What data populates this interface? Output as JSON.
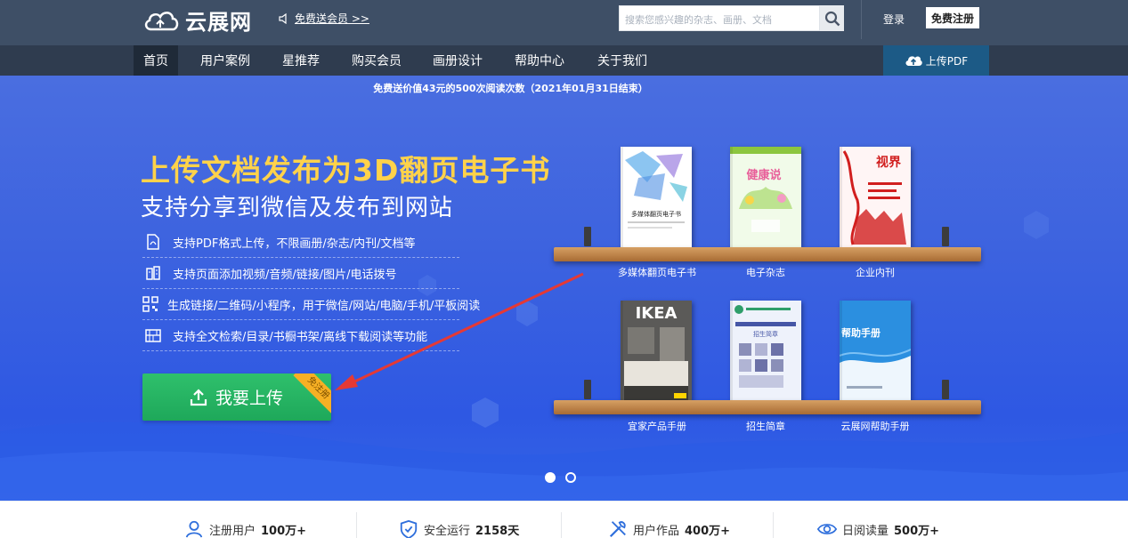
{
  "header": {
    "logo_text": "云展网",
    "promo_text": "免费送会员 >>",
    "search_placeholder": "搜索您感兴趣的杂志、画册、文档",
    "login": "登录",
    "register": "免费注册"
  },
  "nav": {
    "items": [
      {
        "label": "首页",
        "active": true
      },
      {
        "label": "用户案例",
        "active": false
      },
      {
        "label": "星推荐",
        "active": false
      },
      {
        "label": "购买会员",
        "active": false
      },
      {
        "label": "画册设计",
        "active": false
      },
      {
        "label": "帮助中心",
        "active": false
      },
      {
        "label": "关于我们",
        "active": false
      }
    ],
    "upload_pdf": "上传PDF"
  },
  "hero": {
    "promo_line": "免费送价值43元的500次阅读次数（2021年01月31日结束）",
    "headline": "上传文档发布为3D翻页电子书",
    "subheadline": "支持分享到微信及发布到网站",
    "features": [
      {
        "icon": "pdf-file-icon",
        "text": "支持PDF格式上传，不限画册/杂志/内刊/文档等"
      },
      {
        "icon": "media-grid-icon",
        "text": "支持页面添加视频/音频/链接/图片/电话拨号"
      },
      {
        "icon": "qrcode-icon",
        "text": "生成链接/二维码/小程序，用于微信/网站/电脑/手机/平板阅读"
      },
      {
        "icon": "bookshelf-icon",
        "text": "支持全文检索/目录/书橱书架/离线下载阅读等功能"
      }
    ],
    "upload_button": "我要上传",
    "upload_badge": "免注册",
    "books_top": [
      {
        "title": "多媒体翻页电子书",
        "cover_text": "多媒体翻页电子书",
        "cover_color": "#ffffff",
        "accent": "#6fb6ee"
      },
      {
        "title": "电子杂志",
        "cover_text": "健康说",
        "cover_color": "#f1fbe9",
        "accent": "#8cc63f"
      },
      {
        "title": "企业内刊",
        "cover_text": "视界",
        "cover_color": "#fff5f5",
        "accent": "#d11f1f"
      }
    ],
    "books_bottom": [
      {
        "title": "宜家产品手册",
        "cover_text": "IKEA",
        "cover_color": "#5b5a58",
        "accent": "#1a1a1a"
      },
      {
        "title": "招生简章",
        "cover_text": "招生简章",
        "cover_color": "#eef2fb",
        "accent": "#4556a6"
      },
      {
        "title": "云展网帮助手册",
        "cover_text": "帮助手册",
        "cover_color": "#2b8fe0",
        "accent": "#1b6fc7"
      }
    ],
    "carousel_index": 1,
    "carousel_count": 2
  },
  "stats": [
    {
      "icon": "user-icon",
      "label": "注册用户",
      "value": "100万+"
    },
    {
      "icon": "shield-check-icon",
      "label": "安全运行",
      "value": "2158天"
    },
    {
      "icon": "tools-icon",
      "label": "用户作品",
      "value": "400万+"
    },
    {
      "icon": "eye-icon",
      "label": "日阅读量",
      "value": "500万+"
    }
  ],
  "colors": {
    "header_bg": "#3e4f66",
    "nav_bg": "#2f3c4f",
    "hero_bg": "#3d63df",
    "headline": "#ffd24a",
    "upload_btn": "#1ea85a",
    "badge": "#f7b024",
    "arrow": "#e53935"
  }
}
